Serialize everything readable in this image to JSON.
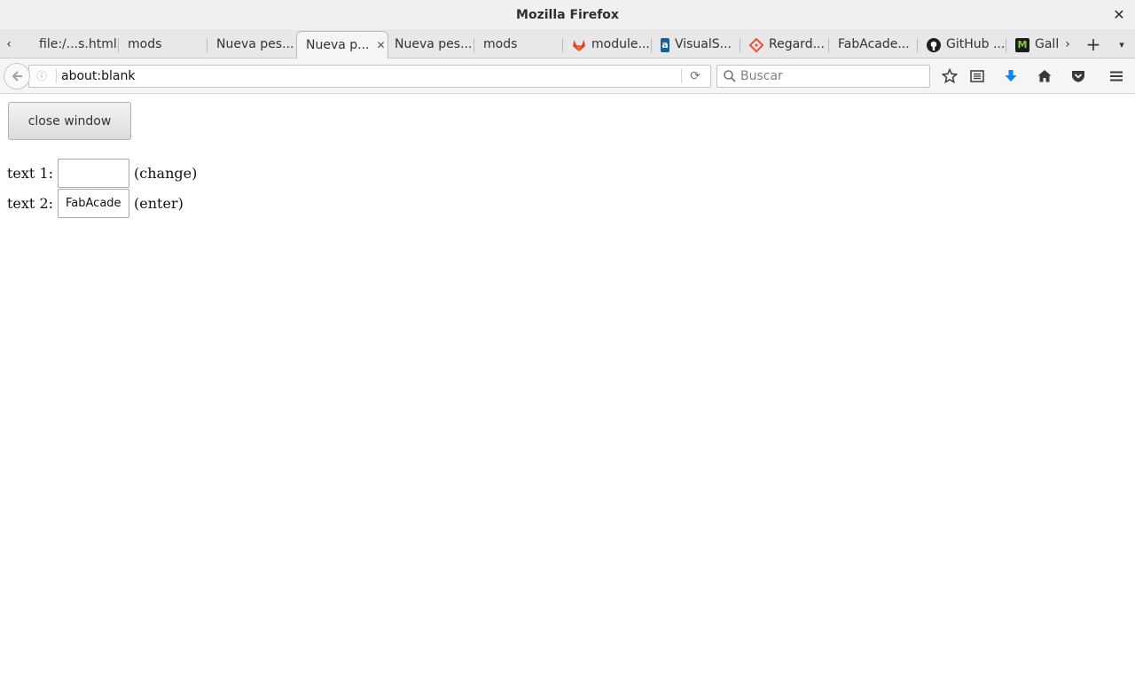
{
  "window": {
    "title": "Mozilla Firefox",
    "close_glyph": "✕"
  },
  "tabs": [
    {
      "label": "file:/...s.html",
      "active": false
    },
    {
      "label": "mods",
      "active": false
    },
    {
      "label": "Nueva pes...",
      "active": false
    },
    {
      "label": "Nueva p...",
      "active": true
    },
    {
      "label": "Nueva pes...",
      "active": false
    },
    {
      "label": "mods",
      "active": false
    },
    {
      "label": "module...",
      "active": false,
      "favicon": "gitlab-icon"
    },
    {
      "label": "VisualS...",
      "active": false,
      "favicon": "a-icon"
    },
    {
      "label": "Regard...",
      "active": false,
      "favicon": "git-icon"
    },
    {
      "label": "FabAcade...",
      "active": false
    },
    {
      "label": "GitHub ...",
      "active": false,
      "favicon": "github-icon"
    },
    {
      "label": "Galle",
      "active": false,
      "favicon": "m-icon"
    }
  ],
  "tab_controls": {
    "scroll_left": "‹",
    "scroll_right": "›",
    "new_tab": "+",
    "all_tabs": "▾"
  },
  "navbar": {
    "url": "about:blank",
    "search_placeholder": "Buscar"
  },
  "page": {
    "close_button_label": "close window",
    "text1_label": "text 1:",
    "text1_value": "",
    "text1_hint": "(change)",
    "text2_label": "text 2:",
    "text2_value": "FabAcademy",
    "text2_hint": "(enter)"
  },
  "colors": {
    "download_arrow": "#0a84ff",
    "gitlab": "#e24329",
    "visualstudio": "#1a5e9a",
    "git": "#f05033",
    "github": "#1b1f23",
    "m_favicon": "#3c8c2c"
  }
}
